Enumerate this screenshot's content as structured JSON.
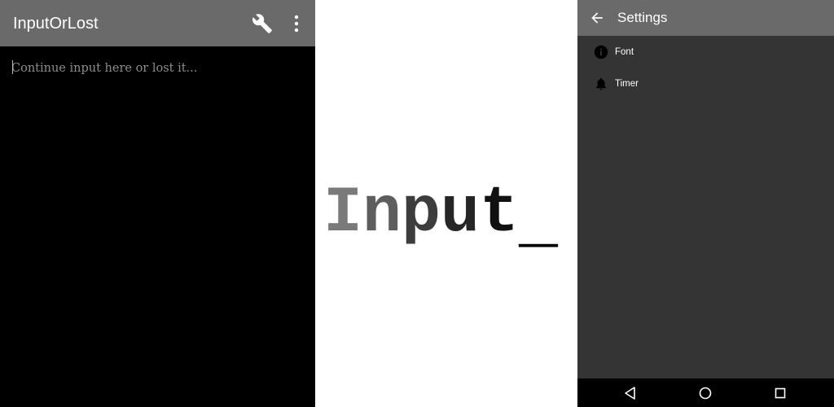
{
  "editor_screen": {
    "app_title": "InputOrLost",
    "toolbar_icons": [
      "wrench-icon",
      "more-vert-icon"
    ],
    "input_placeholder": "Continue input here or lost it...",
    "colors": {
      "app_bar": "#6a6a6a",
      "background": "#000000",
      "placeholder": "#8c8c8c"
    }
  },
  "logo": {
    "text": "Input_",
    "letters": [
      "I",
      "n",
      "p",
      "u",
      "t",
      "_"
    ],
    "letter_colors": [
      "#7a7a7a",
      "#5e5e5e",
      "#3d3d3d",
      "#262626",
      "#111111",
      "#000000"
    ]
  },
  "settings_screen": {
    "title": "Settings",
    "back_icon": "arrow-back-icon",
    "items": [
      {
        "icon": "info-icon",
        "label": "Font"
      },
      {
        "icon": "bell-icon",
        "label": "Timer"
      }
    ],
    "nav_buttons": [
      "back-triangle-icon",
      "home-circle-icon",
      "recents-square-icon"
    ],
    "colors": {
      "app_bar": "#6a6a6a",
      "background": "#343434",
      "nav_bar": "#000000"
    }
  }
}
